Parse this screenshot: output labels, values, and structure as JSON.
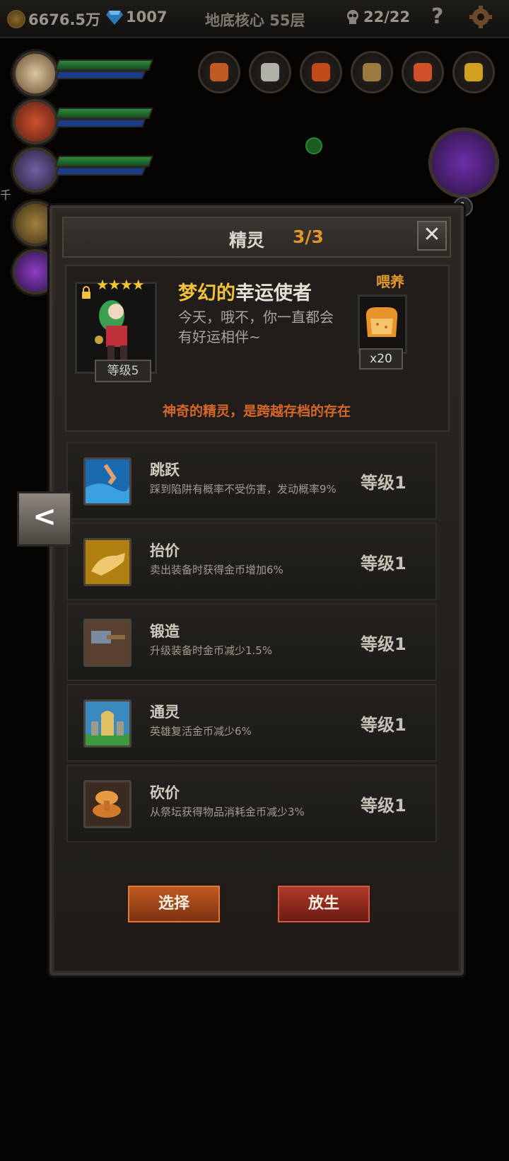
{
  "topbar": {
    "gold": "6676.5万",
    "gems": "1007",
    "floor": "地底核心 55层",
    "kills": "22/22",
    "help_icon": "?"
  },
  "side": {
    "cut_text": "千"
  },
  "colors": {
    "title_accent": "#e0952a",
    "name_accent": "#f2c23a",
    "note": "#d5672a",
    "select_btn": "#c25a22",
    "release_btn": "#b23a2a"
  },
  "badge": "1",
  "modal": {
    "title": "精灵",
    "count": "3/3",
    "close_label": "✕",
    "spirit": {
      "stars": "★★★★",
      "star_count": 4,
      "level": "等级5",
      "name_adj": "梦幻的",
      "name_noun": "幸运使者",
      "desc": "今天，哦不，你一直都会有好运相伴~",
      "feed_label": "喂养",
      "feed_count": "x20",
      "note": "神奇的精灵，是跨越存档的存在"
    },
    "skills": [
      {
        "name": "跳跃",
        "desc": "踩到陷阱有概率不受伤害，发动概率9%",
        "level": "等级1",
        "icon": "jump-icon"
      },
      {
        "name": "抬价",
        "desc": "卖出装备时获得金币增加6%",
        "level": "等级1",
        "icon": "hand-icon"
      },
      {
        "name": "锻造",
        "desc": "升级装备时金币减少1.5%",
        "level": "等级1",
        "icon": "hammer-icon"
      },
      {
        "name": "通灵",
        "desc": "英雄复活金币减少6%",
        "level": "等级1",
        "icon": "tombstone-icon"
      },
      {
        "name": "砍价",
        "desc": "从祭坛获得物品消耗金币减少3%",
        "level": "等级1",
        "icon": "coins-icon"
      }
    ],
    "select_label": "选择",
    "release_label": "放生"
  },
  "nav": {
    "back_label": "<"
  }
}
